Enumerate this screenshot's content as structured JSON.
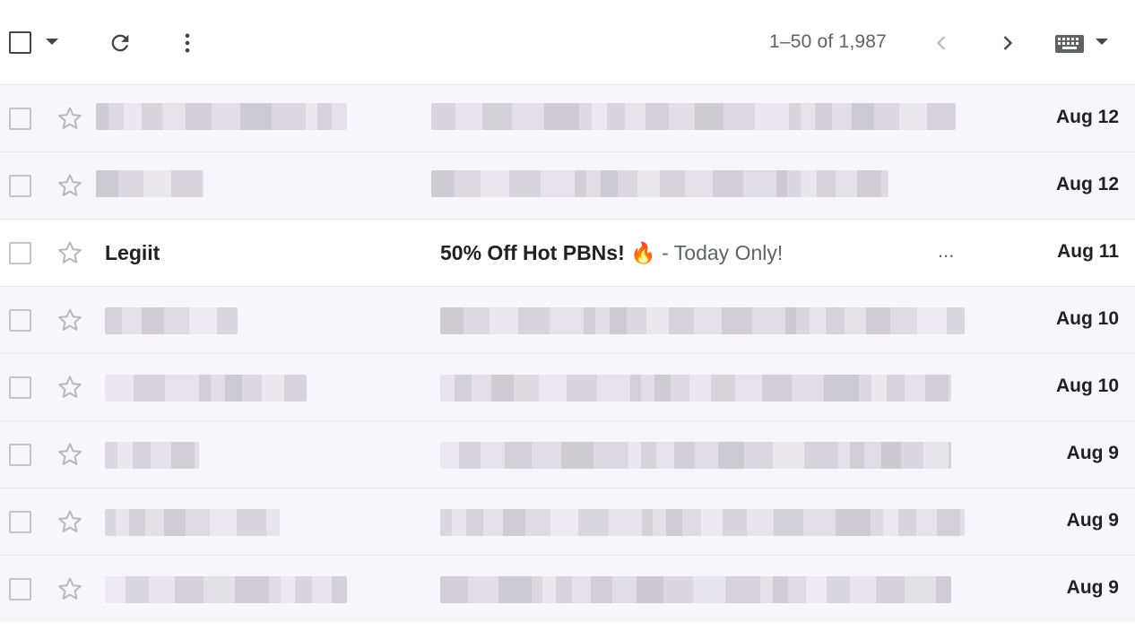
{
  "toolbar": {
    "select_all": "select-all-checkbox",
    "pager": "1–50 of 1,987",
    "icons": [
      "chevron-down-icon",
      "refresh-icon",
      "more-vert-icon",
      "chevron-left-icon",
      "chevron-right-icon",
      "keyboard-icon"
    ]
  },
  "colors": {
    "unread_bg": "#ffffff",
    "read_bg": "#f7f6fa",
    "blur": "#d9d7dc",
    "fire": "#f37a22"
  },
  "emails": [
    {
      "sender": "",
      "subject": "",
      "snippet": "",
      "date": "Aug 12"
    },
    {
      "sender": "",
      "subject": "",
      "snippet": "",
      "date": "Aug 12"
    },
    {
      "sender": "Legiit",
      "subject": "50% Off Hot PBNs! 🔥",
      "snippet": " - Today Only!",
      "ellipsis": "...",
      "date": "Aug 11"
    },
    {
      "sender": "",
      "subject": "",
      "snippet": "",
      "date": "Aug 10"
    },
    {
      "sender": "",
      "subject": "",
      "snippet": "",
      "date": "Aug 10"
    },
    {
      "sender": "",
      "subject": "",
      "snippet": "",
      "date": "Aug 9"
    },
    {
      "sender": "",
      "subject": "",
      "snippet": "",
      "date": "Aug 9"
    },
    {
      "sender": "",
      "subject": "",
      "snippet": "",
      "date": "Aug 9"
    }
  ]
}
